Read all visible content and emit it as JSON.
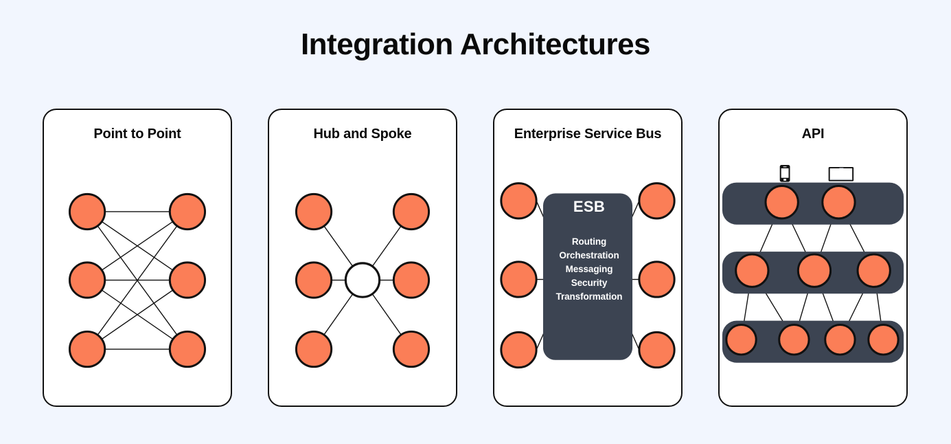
{
  "header": {
    "title": "Integration Architectures"
  },
  "theme": {
    "background": "#f2f6fe",
    "card_background": "#ffffff",
    "card_border": "#111111",
    "node_fill": "#fb7e57",
    "node_border": "#111111",
    "dark_panel": "#3c4452",
    "dark_panel_text": "#ffffff",
    "link_stroke": "#111111",
    "title_color": "#0a0a0a"
  },
  "panels": [
    {
      "id": "point-to-point",
      "title": "Point to Point",
      "pattern": "full-mesh-bipartite",
      "left_nodes": 3,
      "right_nodes": 3,
      "total_nodes": 6,
      "total_links": 9
    },
    {
      "id": "hub-and-spoke",
      "title": "Hub and Spoke",
      "pattern": "star",
      "hub_nodes": 1,
      "spoke_nodes": 6,
      "total_links": 6,
      "hub_fill": "#ffffff"
    },
    {
      "id": "enterprise-service-bus",
      "title": "Enterprise Service Bus",
      "pattern": "bus",
      "bus_label": "ESB",
      "bus_features": [
        "Routing",
        "Orchestration",
        "Messaging",
        "Security",
        "Transformation"
      ],
      "left_nodes": 3,
      "right_nodes": 3,
      "total_links": 6
    },
    {
      "id": "api",
      "title": "API",
      "pattern": "layered-tree",
      "client_icons": [
        "phone-icon",
        "tablet-icon"
      ],
      "layers": [
        {
          "label": "top-layer",
          "nodes": 2
        },
        {
          "label": "middle-layer",
          "nodes": 3
        },
        {
          "label": "bottom-layer",
          "nodes": 4
        }
      ],
      "total_links": 10
    }
  ]
}
